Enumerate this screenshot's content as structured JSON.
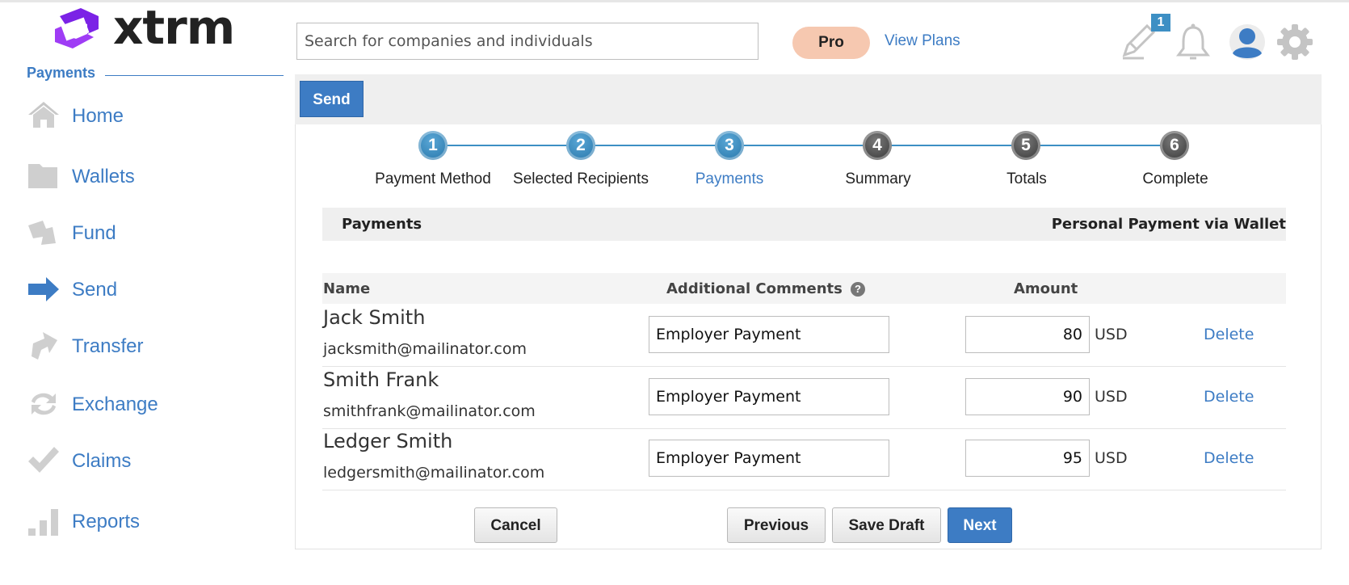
{
  "brand": {
    "name": "xtrm",
    "logo_icon": "xtrm-logo-icon"
  },
  "sidebar": {
    "section_title": "Payments",
    "items": [
      {
        "label": "Home",
        "icon": "home-icon"
      },
      {
        "label": "Wallets",
        "icon": "folder-icon"
      },
      {
        "label": "Fund",
        "icon": "fund-arrow-icon"
      },
      {
        "label": "Send",
        "icon": "send-arrow-icon",
        "active": true
      },
      {
        "label": "Transfer",
        "icon": "transfer-arrow-icon"
      },
      {
        "label": "Exchange",
        "icon": "exchange-icon"
      },
      {
        "label": "Claims",
        "icon": "checkmark-icon"
      },
      {
        "label": "Reports",
        "icon": "bar-chart-icon"
      }
    ]
  },
  "header": {
    "search_placeholder": "Search for companies and individuals",
    "plan_badge": "Pro",
    "view_plans": "View Plans",
    "notes_badge_count": "1",
    "icons": [
      "edit-icon",
      "bell-icon",
      "user-avatar-icon",
      "gear-icon"
    ]
  },
  "toolbar": {
    "send_tab": "Send"
  },
  "stepper": {
    "steps": [
      {
        "number": "1",
        "label": "Payment Method",
        "state": "done"
      },
      {
        "number": "2",
        "label": "Selected Recipients",
        "state": "done"
      },
      {
        "number": "3",
        "label": "Payments",
        "state": "current"
      },
      {
        "number": "4",
        "label": "Summary",
        "state": "todo"
      },
      {
        "number": "5",
        "label": "Totals",
        "state": "todo"
      },
      {
        "number": "6",
        "label": "Complete",
        "state": "todo"
      }
    ]
  },
  "section": {
    "title": "Payments",
    "method": "Personal Payment via Wallet"
  },
  "table": {
    "headers": {
      "name": "Name",
      "comments": "Additional Comments",
      "amount": "Amount"
    },
    "help_glyph": "?",
    "rows": [
      {
        "name": "Jack Smith",
        "email": "jacksmith@mailinator.com",
        "comment": "Employer Payment",
        "amount": "80",
        "currency": "USD",
        "action": "Delete"
      },
      {
        "name": "Smith Frank",
        "email": "smithfrank@mailinator.com",
        "comment": "Employer Payment",
        "amount": "90",
        "currency": "USD",
        "action": "Delete"
      },
      {
        "name": "Ledger Smith",
        "email": "ledgersmith@mailinator.com",
        "comment": "Employer Payment",
        "amount": "95",
        "currency": "USD",
        "action": "Delete"
      }
    ]
  },
  "actions": {
    "cancel": "Cancel",
    "previous": "Previous",
    "save_draft": "Save Draft",
    "next": "Next"
  },
  "colors": {
    "accent": "#3d7cc4",
    "pro_badge": "#f6c8b0",
    "step_done": "#2574a8",
    "step_todo": "#333333"
  }
}
